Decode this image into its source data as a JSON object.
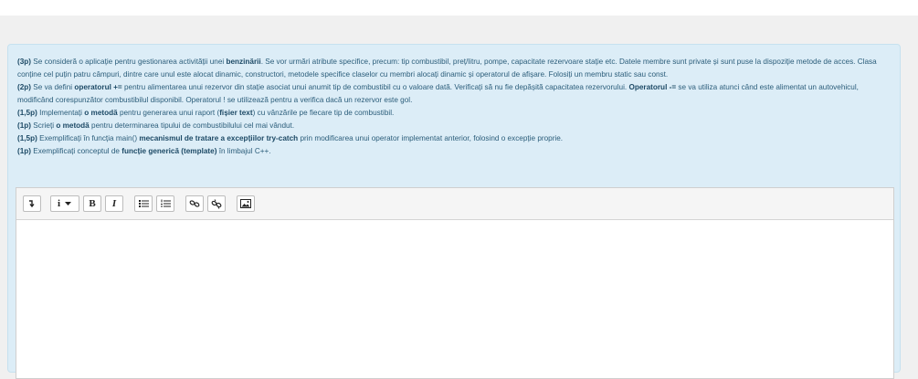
{
  "question": {
    "paragraphs": [
      [
        {
          "t": "(3p)",
          "b": true
        },
        {
          "t": " Se consideră o aplicație pentru gestionarea activității unei "
        },
        {
          "t": "benzinării",
          "b": true
        },
        {
          "t": ". Se vor urmări atribute specifice, precum: tip combustibil, preț/litru, pompe, capacitate rezervoare stație etc. Datele membre sunt private și sunt puse la dispoziție metode de acces. Clasa conține cel puțin patru câmpuri, dintre care unul este alocat dinamic, constructori, metodele specifice claselor cu membri alocați dinamic și operatorul de afișare. Folosiți un membru static sau const."
        }
      ],
      [
        {
          "t": "(2p)",
          "b": true
        },
        {
          "t": " Se va defini "
        },
        {
          "t": "operatorul +=",
          "b": true
        },
        {
          "t": " pentru alimentarea unui rezervor din stație asociat unui anumit tip de combustibil cu o valoare dată. Verificați să nu fie depășită capacitatea rezervorului. "
        },
        {
          "t": "Operatorul -=",
          "b": true
        },
        {
          "t": " se va utiliza atunci când este alimentat un autovehicul, modificând corespunzător combustibilul disponibil. Operatorul ! se utilizează pentru a verifica dacă un rezervor este gol."
        }
      ],
      [
        {
          "t": "(1,5p)",
          "b": true
        },
        {
          "t": " Implementați "
        },
        {
          "t": "o metodă",
          "b": true
        },
        {
          "t": " pentru generarea unui raport ("
        },
        {
          "t": "fișier text",
          "b": true
        },
        {
          "t": ") cu vânzările pe fiecare tip de combustibil."
        }
      ],
      [
        {
          "t": "(1p)",
          "b": true
        },
        {
          "t": " Scrieți "
        },
        {
          "t": "o metodă",
          "b": true
        },
        {
          "t": " pentru determinarea tipului de combustibilului cel mai vândut."
        }
      ],
      [
        {
          "t": "(1,5p)",
          "b": true
        },
        {
          "t": " Exemplificați în funcția main() "
        },
        {
          "t": "mecanismul de tratare a excepțiilor try-catch",
          "b": true
        },
        {
          "t": " prin modificarea unui operator implementat anterior, folosind o excepție proprie."
        }
      ],
      [
        {
          "t": "(1p)",
          "b": true
        },
        {
          "t": " Exemplificați conceptul de "
        },
        {
          "t": "funcție generică (template)",
          "b": true
        },
        {
          "t": " în limbajul C++."
        }
      ]
    ]
  },
  "toolbar": {
    "buttons": [
      {
        "name": "expand-toolbar-button",
        "icon": "arrow-turn-icon"
      },
      {
        "name": "paragraph-style-button",
        "label": "i",
        "icon": "dropdown-caret-icon"
      },
      {
        "name": "bold-button",
        "label": "B"
      },
      {
        "name": "italic-button",
        "label": "I"
      },
      {
        "name": "unordered-list-button",
        "icon": "bullet-list-icon"
      },
      {
        "name": "ordered-list-button",
        "icon": "numbered-list-icon"
      },
      {
        "name": "link-button",
        "icon": "link-icon"
      },
      {
        "name": "unlink-button",
        "icon": "unlink-icon"
      },
      {
        "name": "image-button",
        "icon": "image-icon"
      }
    ]
  },
  "colors": {
    "question_bg": "#dcedf7",
    "question_text": "#2b5d7a",
    "page_bg": "#f0f0f0"
  }
}
